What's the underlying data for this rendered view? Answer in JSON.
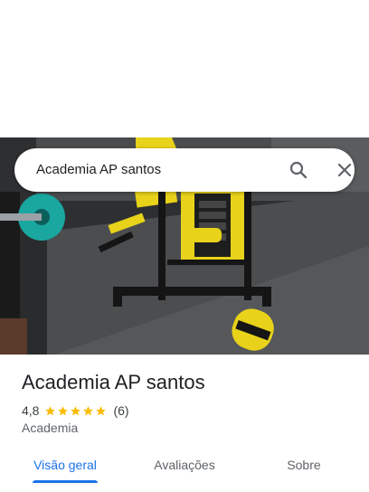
{
  "search": {
    "query": "Academia AP santos"
  },
  "place": {
    "name": "Academia AP santos",
    "rating": "4,8",
    "stars": 5,
    "review_count": "(6)",
    "category": "Academia"
  },
  "tabs": [
    {
      "label": "Visão geral",
      "active": true
    },
    {
      "label": "Avaliações",
      "active": false
    },
    {
      "label": "Sobre",
      "active": false
    }
  ],
  "colors": {
    "accent": "#1a73e8",
    "star": "#fbbc04",
    "text": "#202124"
  },
  "icons": {
    "search": "search-icon",
    "close": "close-icon",
    "star": "star-icon"
  }
}
